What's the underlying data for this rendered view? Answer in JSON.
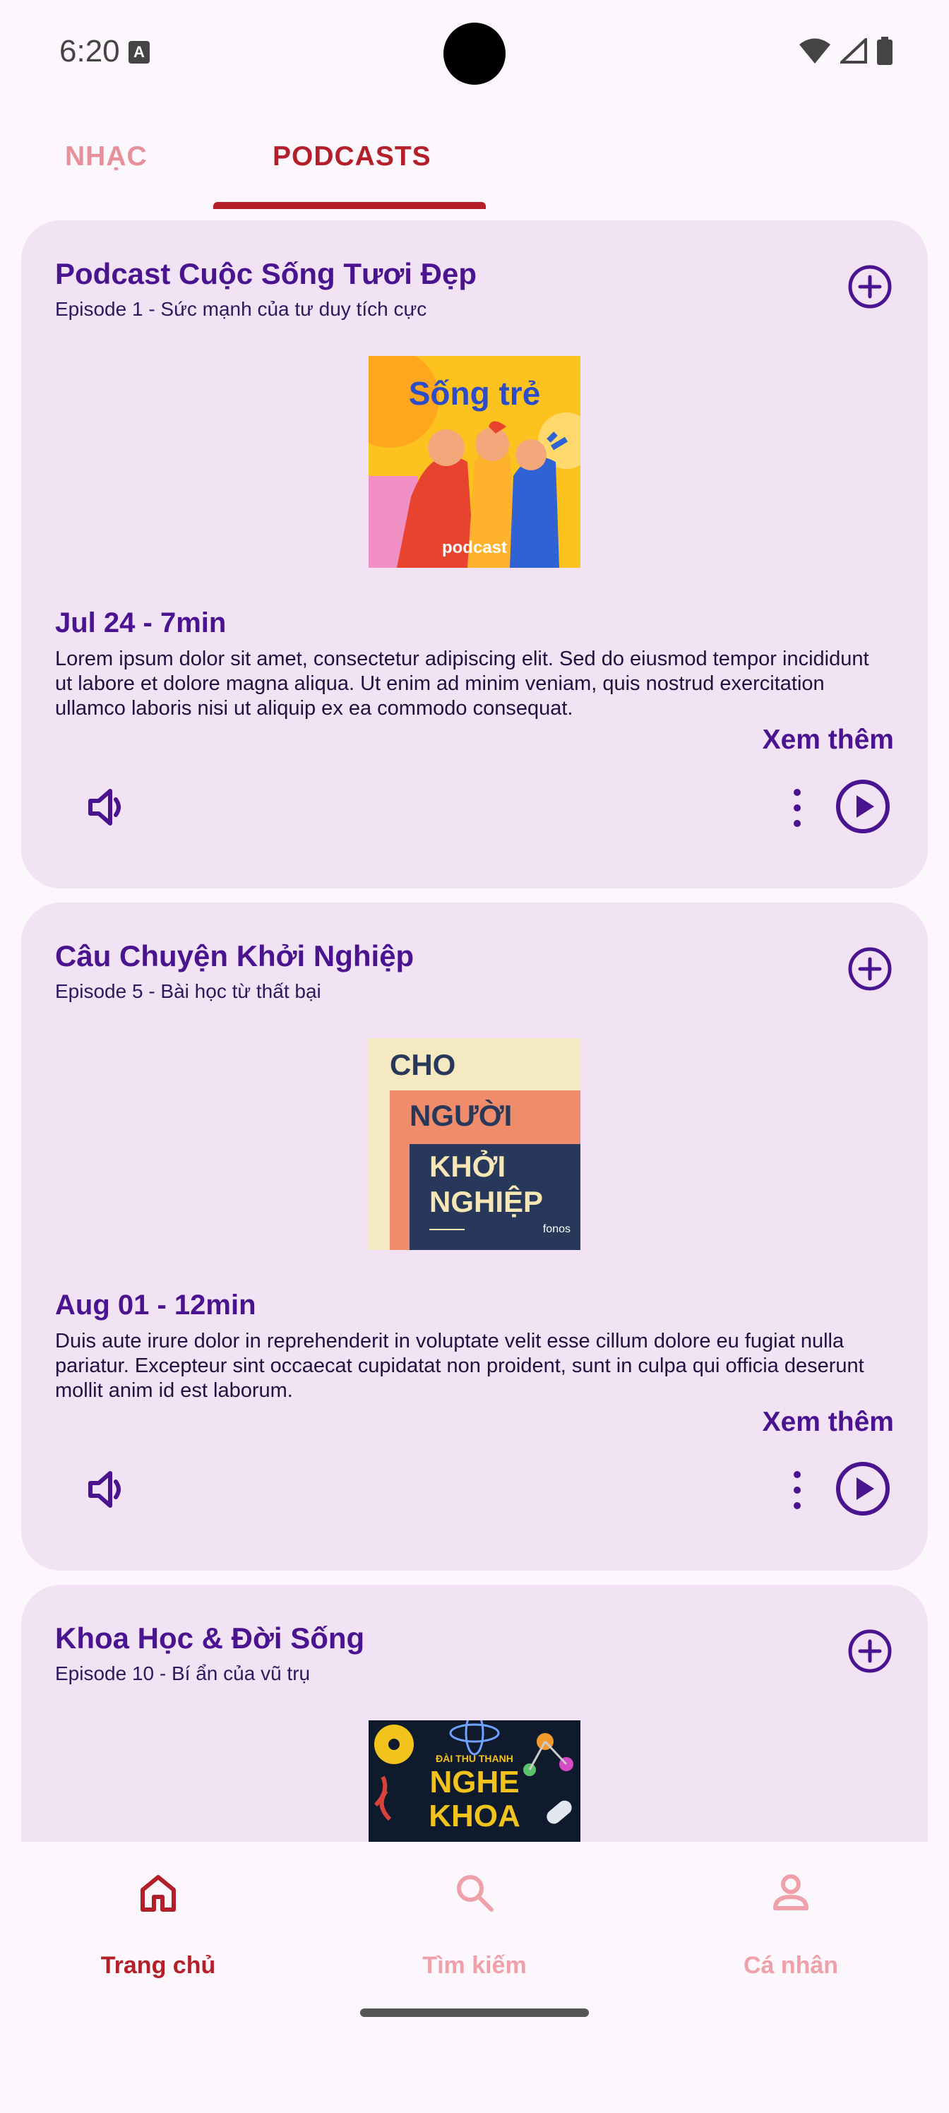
{
  "status_bar": {
    "time": "6:20",
    "notification_badge": "A"
  },
  "tabs": [
    {
      "label": "NHẠC",
      "active": false
    },
    {
      "label": "PODCASTS",
      "active": true
    }
  ],
  "podcasts": [
    {
      "title": "Podcast Cuộc Sống Tươi Đẹp",
      "episode": "Episode 1 - Sức mạnh của tư duy tích cực",
      "cover_text": "Sống trẻ",
      "cover_brand": "podcast",
      "meta": "Jul 24 - 7min",
      "description": "Lorem ipsum dolor sit amet, consectetur adipiscing elit. Sed do eiusmod tempor incididunt ut labore et dolore magna aliqua. Ut enim ad minim veniam, quis nostrud exercitation ullamco laboris nisi ut aliquip ex ea commodo consequat.",
      "see_more": "Xem thêm"
    },
    {
      "title": "Câu Chuyện Khởi Nghiệp",
      "episode": "Episode 5 - Bài học từ thất bại",
      "cover_line1": "CHO",
      "cover_line2": "NGƯỜI",
      "cover_line3": "KHỞI",
      "cover_line4": "NGHIỆP",
      "cover_brand": "fonos",
      "meta": "Aug 01 - 12min",
      "description": "Duis aute irure dolor in reprehenderit in voluptate velit esse cillum dolore eu fugiat nulla pariatur. Excepteur sint occaecat cupidatat non proident, sunt in culpa qui officia deserunt mollit anim id est laborum.",
      "see_more": "Xem thêm"
    },
    {
      "title": "Khoa Học & Đời Sống",
      "episode": "Episode 10 - Bí ẩn của vũ trụ",
      "cover_small": "ĐÀI THU THANH",
      "cover_line1": "NGHE",
      "cover_line2": "KHOA"
    }
  ],
  "bottom_nav": [
    {
      "label": "Trang chủ",
      "icon": "home-icon",
      "active": true
    },
    {
      "label": "Tìm kiếm",
      "icon": "search-icon",
      "active": false
    },
    {
      "label": "Cá nhân",
      "icon": "person-icon",
      "active": false
    }
  ],
  "colors": {
    "accent": "#b3202a",
    "primary_text": "#4a138f",
    "card_bg": "#f1e3f3",
    "inactive": "#f0a0a8"
  }
}
